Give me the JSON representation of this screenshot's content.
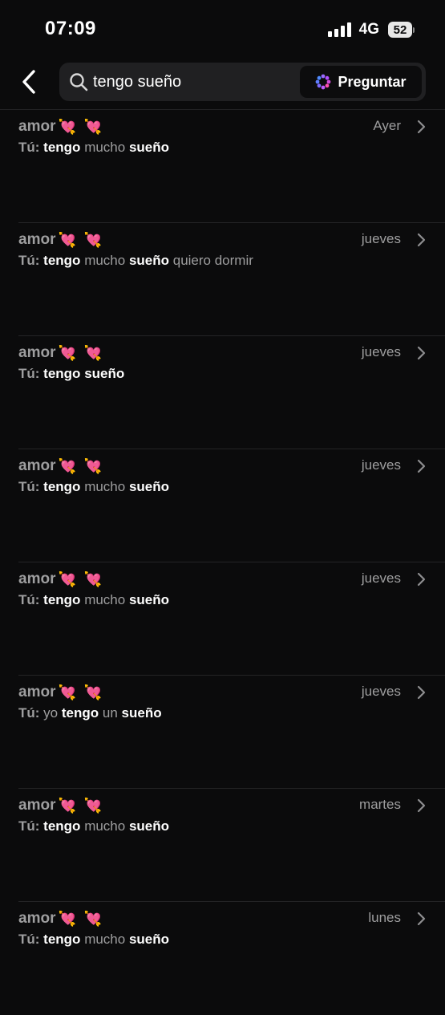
{
  "status_bar": {
    "time": "07:09",
    "network": "4G",
    "battery": "52",
    "signal_icon": "cellular-signal-icon",
    "battery_icon": "battery-icon"
  },
  "search": {
    "back_icon": "chevron-left-icon",
    "search_icon": "magnifying-glass-icon",
    "query": "tengo sueño",
    "ask_label": "Preguntar",
    "ask_icon": "meta-ai-sparkle-icon"
  },
  "colors": {
    "background": "#0b0b0c",
    "search_box": "#202022",
    "muted_text": "#9e9e9f",
    "highlight_text": "#ffffff",
    "ask_icon_gradient": [
      "#4f8bff",
      "#b04dff",
      "#ff4fb0"
    ],
    "heart_emoji": "#ff3e93"
  },
  "results": [
    {
      "contact": "amor",
      "emoji": "💘 💘",
      "date": "Ayer",
      "sender": "Tú:",
      "segments": [
        {
          "text": "tengo",
          "match": true
        },
        {
          "text": "mucho",
          "match": false
        },
        {
          "text": "sueño",
          "match": true
        }
      ]
    },
    {
      "contact": "amor",
      "emoji": "💘 💘",
      "date": "jueves",
      "sender": "Tú:",
      "segments": [
        {
          "text": "tengo",
          "match": true
        },
        {
          "text": "mucho",
          "match": false
        },
        {
          "text": "sueño",
          "match": true
        },
        {
          "text": "quiero dormir",
          "match": false
        }
      ]
    },
    {
      "contact": "amor",
      "emoji": "💘 💘",
      "date": "jueves",
      "sender": "Tú:",
      "segments": [
        {
          "text": "tengo",
          "match": true
        },
        {
          "text": "sueño",
          "match": true
        }
      ]
    },
    {
      "contact": "amor",
      "emoji": "💘 💘",
      "date": "jueves",
      "sender": "Tú:",
      "segments": [
        {
          "text": "tengo",
          "match": true
        },
        {
          "text": "mucho",
          "match": false
        },
        {
          "text": "sueño",
          "match": true
        }
      ]
    },
    {
      "contact": "amor",
      "emoji": "💘 💘",
      "date": "jueves",
      "sender": "Tú:",
      "segments": [
        {
          "text": "tengo",
          "match": true
        },
        {
          "text": "mucho",
          "match": false
        },
        {
          "text": "sueño",
          "match": true
        }
      ]
    },
    {
      "contact": "amor",
      "emoji": "💘 💘",
      "date": "jueves",
      "sender": "Tú:",
      "segments": [
        {
          "text": "yo",
          "match": false
        },
        {
          "text": "tengo",
          "match": true
        },
        {
          "text": "un",
          "match": false
        },
        {
          "text": "sueño",
          "match": true
        }
      ]
    },
    {
      "contact": "amor",
      "emoji": "💘 💘",
      "date": "martes",
      "sender": "Tú:",
      "segments": [
        {
          "text": "tengo",
          "match": true
        },
        {
          "text": "mucho",
          "match": false
        },
        {
          "text": "sueño",
          "match": true
        }
      ]
    },
    {
      "contact": "amor",
      "emoji": "💘 💘",
      "date": "lunes",
      "sender": "Tú:",
      "segments": [
        {
          "text": "tengo",
          "match": true
        },
        {
          "text": "mucho",
          "match": false
        },
        {
          "text": "sueño",
          "match": true
        }
      ]
    }
  ]
}
